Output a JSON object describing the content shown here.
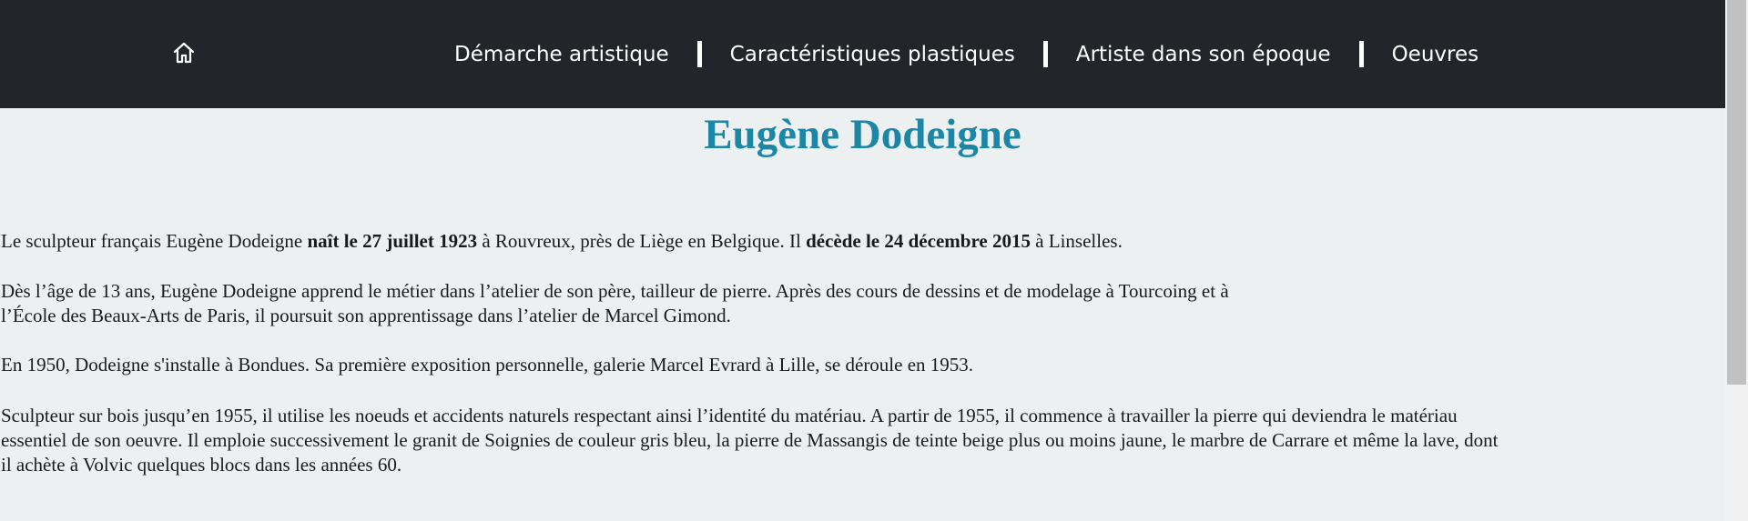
{
  "nav": {
    "home_icon": "home-icon",
    "items": [
      {
        "label": "Démarche artistique"
      },
      {
        "label": "Caractéristiques plastiques"
      },
      {
        "label": "Artiste dans son époque"
      },
      {
        "label": "Oeuvres"
      }
    ]
  },
  "main": {
    "title": "Eugène Dodeigne",
    "p1": {
      "t1": "Le sculpteur français Eugène Dodeigne ",
      "b1": "naît le 27 juillet 1923",
      "t2": " à Rouvreux, près de Liège en Belgique. Il ",
      "b2": "décède le 24 décembre 2015",
      "t3": " à Linselles."
    },
    "p2": {
      "line1": "Dès l’âge de 13 ans, Eugène Dodeigne apprend le métier dans l’atelier de son père, tailleur de pierre. Après des cours de dessins et de modelage à Tourcoing et à",
      "line2": "l’École des Beaux-Arts de Paris, il poursuit son apprentissage dans l’atelier de Marcel Gimond."
    },
    "p3": "En 1950, Dodeigne s'installe à Bondues. Sa première exposition personnelle, galerie Marcel Evrard à Lille, se déroule en 1953.",
    "p4": {
      "line1": "Sculpteur sur bois jusqu’en 1955, il utilise les noeuds et accidents naturels respectant ainsi l’identité du matériau. A partir de 1955, il commence à travailler la pierre qui deviendra le matériau",
      "line2": "essentiel de son oeuvre. Il emploie successivement le granit de Soignies de couleur gris bleu, la pierre de Massangis de teinte beige plus ou moins jaune, le marbre de Carrare et même la lave, dont",
      "line3": "il achète à Volvic quelques blocs dans les années 60."
    }
  },
  "colors": {
    "navbar_bg": "#24252a",
    "page_bg": "#edf0f1",
    "title": "#1b86a5"
  }
}
